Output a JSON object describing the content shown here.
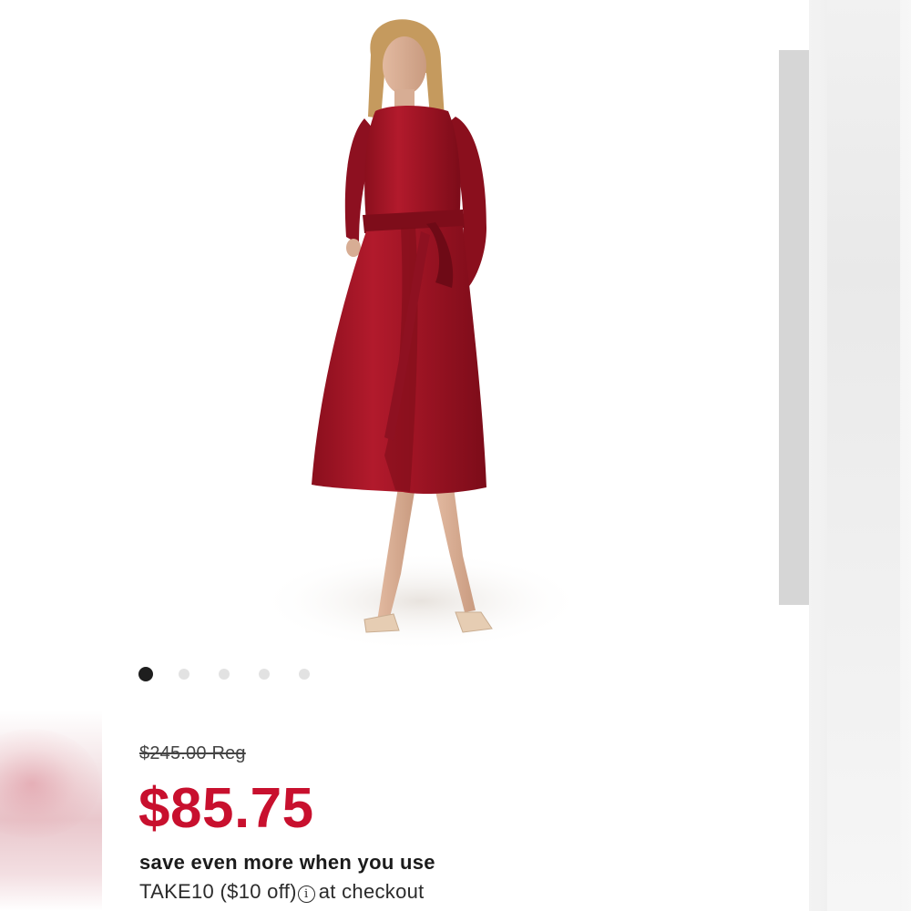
{
  "product": {
    "image_alt": "red satin wrap midi dress",
    "carousel": {
      "total": 5,
      "active_index": 0
    }
  },
  "pricing": {
    "regular": "$245.00 Reg",
    "sale": "$85.75"
  },
  "promo": {
    "heading": "save even more when you use",
    "code": "TAKE10",
    "discount": "($10 off)",
    "info_icon": "info-icon",
    "suffix": "at checkout"
  },
  "colors": {
    "sale_price": "#c8102e",
    "dress": "#9e1424",
    "active_dot": "#1e1e1e",
    "inactive_dot": "#e2e2e2"
  }
}
